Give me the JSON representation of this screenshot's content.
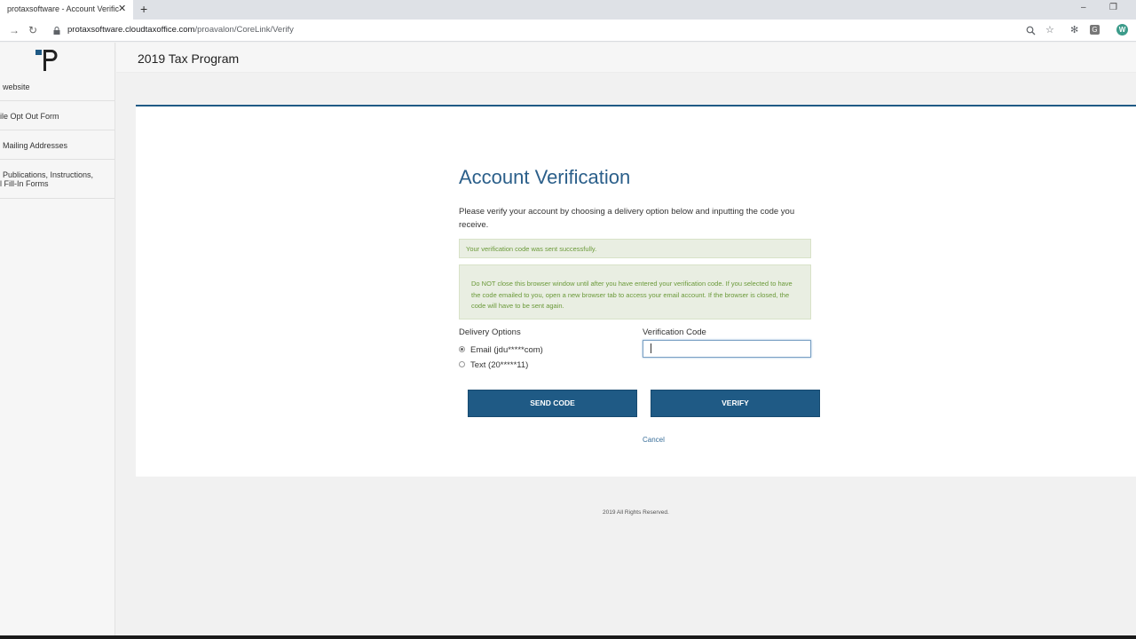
{
  "browser": {
    "tab_title": "protaxsoftware - Account Verific",
    "tab_close": "✕",
    "new_tab": "+",
    "url_host": "protaxsoftware.cloudtaxoffice.com",
    "url_path": "/proavalon/CoreLink/Verify",
    "minimize": "–",
    "restore": "❐",
    "ext_g": "G",
    "ext_w": "W"
  },
  "sidebar": {
    "items": [
      {
        "label": "website"
      },
      {
        "label": "ile Opt Out Form"
      },
      {
        "label": "Mailing Addresses"
      },
      {
        "label": "Publications, Instructions,",
        "label2": "l Fill-In Forms"
      }
    ]
  },
  "header": {
    "title": "2019 Tax Program"
  },
  "verification": {
    "heading": "Account Verification",
    "intro": "Please verify your account by choosing a delivery option below and inputting the code you receive.",
    "success_message": "Your verification code was sent successfully.",
    "warning_message": "Do NOT close this browser window until after you have entered your verification code. If you selected to have the code emailed to you, open a new browser tab to access your email account. If the browser is closed, the code will have to be sent again.",
    "delivery_label": "Delivery Options",
    "options": [
      {
        "label": "Email (jdu*****com)",
        "selected": true
      },
      {
        "label": "Text (20*****11)",
        "selected": false
      }
    ],
    "code_label": "Verification Code",
    "code_value": "",
    "send_code_label": "SEND CODE",
    "verify_label": "VERIFY",
    "cancel_label": "Cancel"
  },
  "footer": {
    "text": "2019 All Rights Reserved."
  },
  "colors": {
    "accent": "#1f5a85",
    "heading": "#2b5f8a",
    "success_text": "#6b9a3a",
    "alert_bg": "#e9eee2"
  }
}
